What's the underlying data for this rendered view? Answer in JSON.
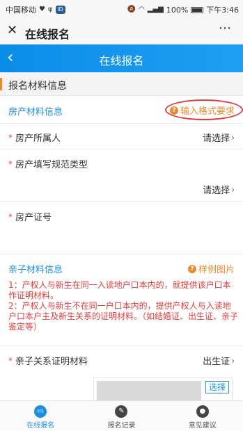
{
  "status_bar": {
    "carrier": "中国移动",
    "battery": "100%",
    "time": "下午3:46"
  },
  "wechat_bar": {
    "close_icon": "close-icon",
    "title": "在线报名",
    "more": "⋯"
  },
  "app_bar": {
    "back_icon": "back-arrow-icon",
    "title": "在线报名"
  },
  "section": {
    "title": "报名材料信息"
  },
  "property": {
    "group_label": "房产材料信息",
    "format_link": "输入格式要求",
    "owner_label": "房产所属人",
    "owner_value": "请选择",
    "type_label": "房产填写规范类型",
    "type_value": "请选择",
    "cert_label": "房产证号"
  },
  "relation": {
    "group_label": "亲子材料信息",
    "sample_link": "样例图片",
    "note": "1：产权人与新生在同一入读地户口本内的，就提供该户口本作证明材料。\n2：产权人与新生不在同一户口本内的，提供产权人与入读地户口本户主及新生关系的证明材料。（如结婚证、出生证、亲子鉴定等）",
    "proof_label": "亲子关系证明材料",
    "proof_value": "出生证",
    "choose_button": "选择"
  },
  "tabs": [
    {
      "label": "在线报名",
      "icon": "computer-icon",
      "active": true
    },
    {
      "label": "报名记录",
      "icon": "pen-icon",
      "active": false
    },
    {
      "label": "意见建议",
      "icon": "person-icon",
      "active": false
    }
  ],
  "colors": {
    "primary": "#1d8fe1",
    "accent": "#e98a2d",
    "alert": "#e23b3b"
  }
}
